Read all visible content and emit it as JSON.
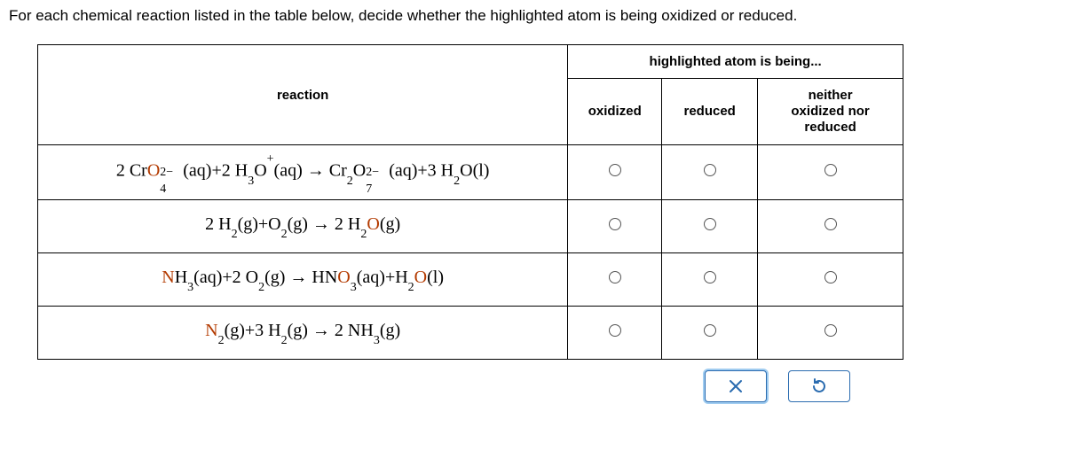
{
  "instruction": "For each chemical reaction listed in the table below, decide whether the highlighted atom is being oxidized or reduced.",
  "headers": {
    "reaction": "reaction",
    "group": "highlighted atom is being...",
    "oxidized": "oxidized",
    "reduced": "reduced",
    "neither_l1": "neither",
    "neither_l2": "oxidized nor",
    "neither_l3": "reduced"
  },
  "reactions": [
    {
      "text": "2 CrO4^2-(aq) + 2 H3O^+(aq) → Cr2O7^2-(aq) + 3 H2O(l)",
      "highlighted": "O (in CrO4^2-)",
      "html_index": 0,
      "selected": null
    },
    {
      "text": "2 H2(g) + O2(g) → 2 H2O(g)",
      "highlighted": "O (in product H2O)",
      "html_index": 1,
      "selected": null
    },
    {
      "text": "NH3(aq) + 2 O2(g) → HNO3(aq) + H2O(l)",
      "highlighted": "N (in NH3) and O (in HNO3/H2O products)",
      "html_index": 2,
      "selected": null
    },
    {
      "text": "N2(g) + 3 H2(g) → 2 NH3(g)",
      "highlighted": "N (in N2)",
      "html_index": 3,
      "selected": null
    }
  ],
  "buttons": {
    "close": "×",
    "reset": "↺"
  }
}
